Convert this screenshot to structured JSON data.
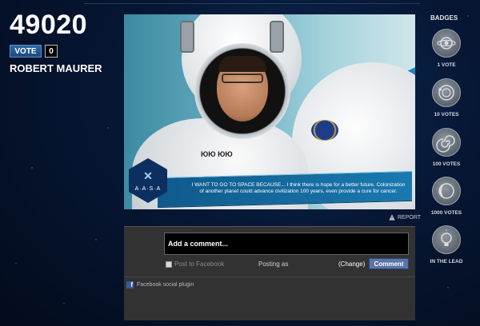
{
  "left_panel": {
    "vote_count": "49020",
    "vote_label": "VOTE",
    "vote_badge": "0",
    "user_name": "ROBERT MAURER"
  },
  "photo": {
    "suit_text": "ЮЮ ЮЮ",
    "logo_text": "A·A·S·A",
    "banner_text": "I WANT TO GO TO SPACE BECAUSE... I think there is hope for a better future. Colonization of another planet could advance civilization 100 years, even provide a cure for cancer."
  },
  "report": {
    "label": "REPORT",
    "icon": "warning-icon"
  },
  "comments": {
    "placeholder": "Add a comment...",
    "post_to_facebook": "Post to Facebook",
    "posting_as": "Posting as",
    "change": "(Change)",
    "submit": "Comment",
    "plugin": "Facebook social plugin"
  },
  "badges": {
    "title": "BADGES",
    "items": [
      {
        "label": "1 VOTE",
        "icon": "planet-icon"
      },
      {
        "label": "10 VOTES",
        "icon": "orbit-icon"
      },
      {
        "label": "100 VOTES",
        "icon": "spiral-galaxy-icon"
      },
      {
        "label": "1000 VOTES",
        "icon": "eclipse-icon"
      },
      {
        "label": "IN THE LEAD",
        "icon": "lightbulb-icon"
      }
    ]
  },
  "colors": {
    "accent": "#2f6aa6",
    "comment_button": "#5b74a8",
    "banner": "#1a79b0",
    "background": "#061633"
  }
}
